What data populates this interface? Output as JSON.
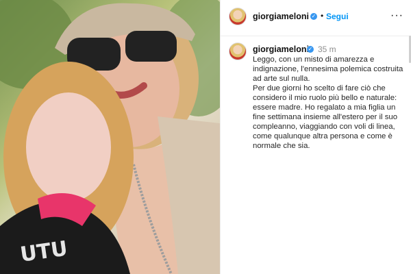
{
  "header": {
    "username": "giorgiameloni",
    "dot": "•",
    "follow_label": "Segui",
    "more": "···"
  },
  "post": {
    "username": "giorgiameloni",
    "time": "35 m",
    "caption_p1": "Leggo, con un misto di amarezza e indignazione, l'ennesima polemica costruita ad arte sul nulla.",
    "caption_p2": "Per due giorni ho scelto di fare ciò che considero il mio ruolo più bello e naturale: essere madre. Ho regalato a mia figlia un fine settimana insieme all'estero per il suo compleanno, viaggiando con voli di linea, come qualunque altra persona e come è normale che sia."
  },
  "photo": {
    "shirt_text": "UTU"
  },
  "icons": {
    "verified": "verified-badge-icon",
    "more": "more-options-icon"
  },
  "colors": {
    "accent": "#0095f6",
    "verified": "#3897f0"
  }
}
